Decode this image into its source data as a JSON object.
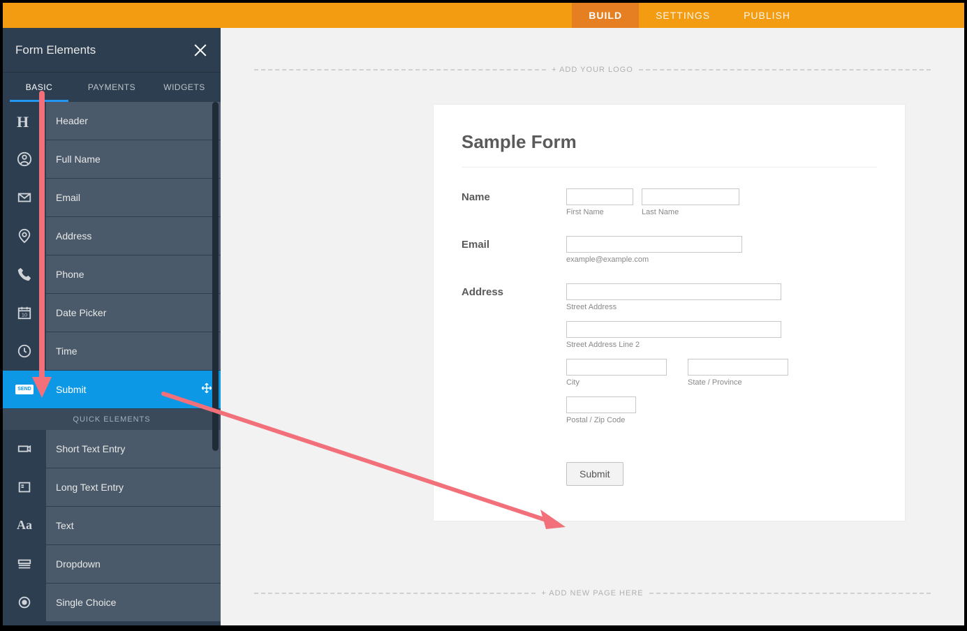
{
  "topnav": {
    "tabs": [
      {
        "id": "build",
        "label": "BUILD",
        "active": true
      },
      {
        "id": "settings",
        "label": "SETTINGS",
        "active": false
      },
      {
        "id": "publish",
        "label": "PUBLISH",
        "active": false
      }
    ]
  },
  "sidebar": {
    "title": "Form Elements",
    "tabs": [
      {
        "id": "basic",
        "label": "BASIC",
        "active": true
      },
      {
        "id": "payments",
        "label": "PAYMENTS",
        "active": false
      },
      {
        "id": "widgets",
        "label": "WIDGETS",
        "active": false
      }
    ],
    "elements": [
      {
        "id": "header",
        "label": "Header",
        "icon": "header-icon"
      },
      {
        "id": "fullname",
        "label": "Full Name",
        "icon": "user-icon"
      },
      {
        "id": "email",
        "label": "Email",
        "icon": "mail-icon"
      },
      {
        "id": "address",
        "label": "Address",
        "icon": "pin-icon"
      },
      {
        "id": "phone",
        "label": "Phone",
        "icon": "phone-icon"
      },
      {
        "id": "datepicker",
        "label": "Date Picker",
        "icon": "calendar-icon"
      },
      {
        "id": "time",
        "label": "Time",
        "icon": "clock-icon"
      },
      {
        "id": "submit",
        "label": "Submit",
        "icon": "send-icon",
        "active": true
      }
    ],
    "quick_section": "QUICK ELEMENTS",
    "quick_elements": [
      {
        "id": "short-text",
        "label": "Short Text Entry",
        "icon": "short-text-icon"
      },
      {
        "id": "long-text",
        "label": "Long Text Entry",
        "icon": "long-text-icon"
      },
      {
        "id": "text",
        "label": "Text",
        "icon": "text-icon"
      },
      {
        "id": "dropdown",
        "label": "Dropdown",
        "icon": "dropdown-icon"
      },
      {
        "id": "single-choice",
        "label": "Single Choice",
        "icon": "radio-icon"
      }
    ]
  },
  "canvas": {
    "logo_hint": "+ ADD YOUR LOGO",
    "newpage_hint": "+ ADD NEW PAGE HERE",
    "form": {
      "title": "Sample Form",
      "name": {
        "label": "Name",
        "first_sub": "First Name",
        "last_sub": "Last Name"
      },
      "email": {
        "label": "Email",
        "hint": "example@example.com"
      },
      "address": {
        "label": "Address",
        "street_sub": "Street Address",
        "street2_sub": "Street Address Line 2",
        "city_sub": "City",
        "state_sub": "State / Province",
        "zip_sub": "Postal / Zip Code"
      },
      "submit_label": "Submit"
    }
  }
}
